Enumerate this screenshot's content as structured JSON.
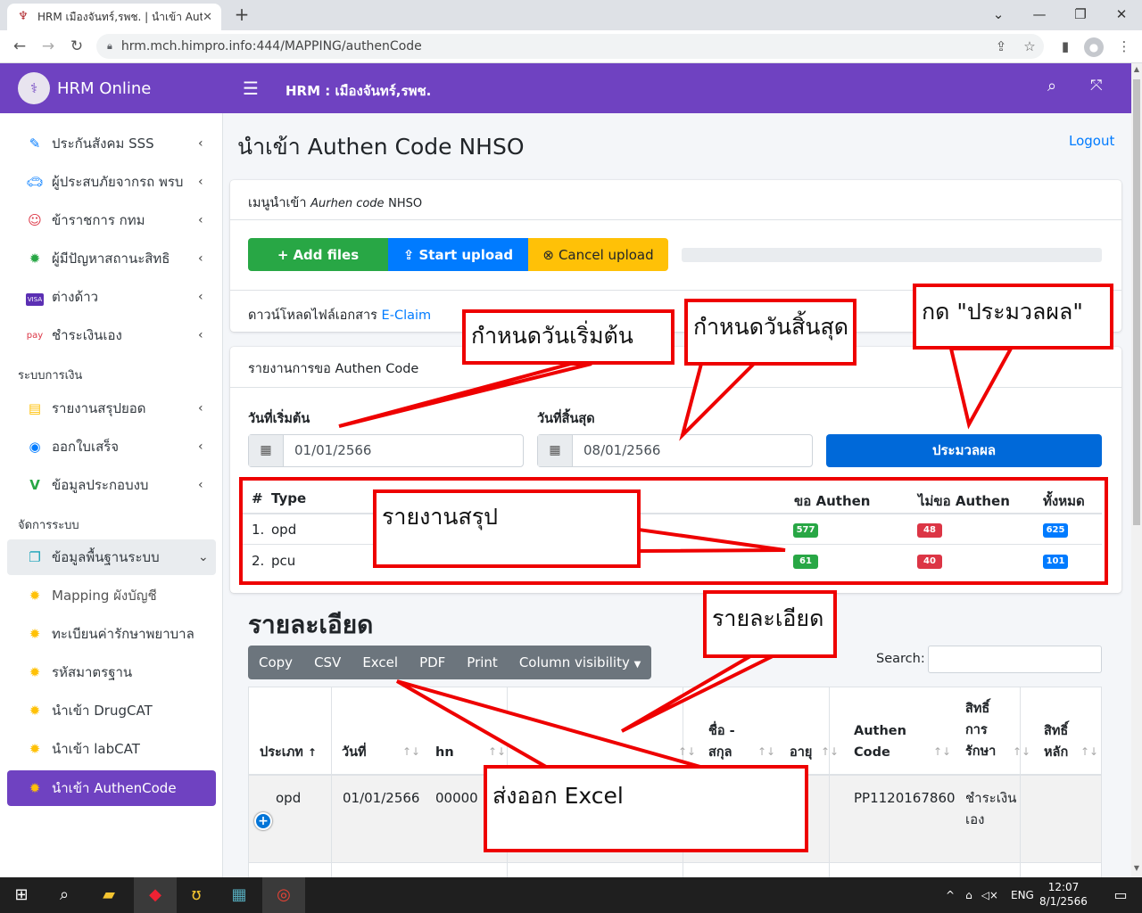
{
  "browser": {
    "tab_title": "HRM เมืองจันทร์,รพช. | นำเข้า Authe",
    "url": "hrm.mch.himpro.info:444/MAPPING/authenCode"
  },
  "brand": {
    "name": "HRM Online"
  },
  "topnav": {
    "title": "HRM : เมืองจันทร์,รพช."
  },
  "sidebar": {
    "items": [
      {
        "label": "ประกันสังคม SSS",
        "icon": "edit-icon"
      },
      {
        "label": "ผู้ประสบภัยจากรถ พรบ",
        "icon": "car-crash-icon"
      },
      {
        "label": "ข้าราชการ กทม",
        "icon": "accessibility-icon"
      },
      {
        "label": "ผู้มีปัญหาสถานะสิทธิ",
        "icon": "gear-icon"
      },
      {
        "label": "ต่างด้าว",
        "icon": "visa-icon"
      },
      {
        "label": "ชำระเงินเอง",
        "icon": "pay-icon"
      }
    ],
    "finance_header": "ระบบการเงิน",
    "finance_items": [
      {
        "label": "รายงานสรุปยอด"
      },
      {
        "label": "ออกใบเสร็จ"
      },
      {
        "label": "ข้อมูลประกอบงบ"
      }
    ],
    "admin_header": "จัดการระบบ",
    "admin_items": [
      {
        "label": "ข้อมูลพื้นฐานระบบ"
      },
      {
        "label": "Mapping ผังบัญชี"
      },
      {
        "label": "ทะเบียนค่ารักษาพยาบาล"
      },
      {
        "label": "รหัสมาตรฐาน"
      },
      {
        "label": "นำเข้า DrugCAT"
      },
      {
        "label": "นำเข้า labCAT"
      },
      {
        "label": "นำเข้า AuthenCode"
      }
    ]
  },
  "page": {
    "title": "นำเข้า Authen Code NHSO",
    "logout": "Logout",
    "import_card_header_prefix": "เมนูนำเข้า",
    "import_card_header_italic": "Aurhen code",
    "import_card_header_suffix": "NHSO",
    "add_files": "Add files",
    "start_upload": "Start upload",
    "cancel_upload": "Cancel upload",
    "download_prefix": "ดาวน์โหลดไฟล์เอกสาร",
    "download_link": "E-Claim",
    "report_header": "รายงานการขอ Authen Code",
    "start_label": "วันที่เริ่มต้น",
    "start_value": "01/01/2566",
    "end_label": "วันที่สิ้นสุด",
    "end_value": "08/01/2566",
    "process_button": "ประมวลผล"
  },
  "summary": {
    "headers": [
      "#",
      "Type",
      "ขอ Authen",
      "ไม่ขอ Authen",
      "ทั้งหมด"
    ],
    "rows": [
      {
        "no": "1.",
        "type": "opd",
        "authen": "577",
        "no_authen": "48",
        "total": "625"
      },
      {
        "no": "2.",
        "type": "pcu",
        "authen": "61",
        "no_authen": "40",
        "total": "101"
      }
    ]
  },
  "detail": {
    "title": "รายละเอียด",
    "buttons": [
      "Copy",
      "CSV",
      "Excel",
      "PDF",
      "Print",
      "Column visibility"
    ],
    "search_label": "Search:",
    "columns": [
      "ประเภท",
      "วันที่",
      "hn",
      "",
      "",
      "ชื่อ -",
      "สกุล",
      "อายุ",
      "Authen",
      "Code",
      "สิทธิ์",
      "การ",
      "รักษา",
      "สิทธิ์",
      "หลัก"
    ],
    "row": {
      "type": "opd",
      "date": "01/01/2566",
      "hn": "00000",
      "authen_code": "PP1120167860",
      "right1": "ชำระเงิน",
      "right2": "เอง"
    }
  },
  "annotations": {
    "start": "กำหนดวันเริ่มต้น",
    "end": "กำหนดวันสิ้นสุด",
    "process": "กด \"ประมวลผล\"",
    "summary": "รายงานสรุป",
    "detail": "รายละเอียด",
    "excel": "ส่งออก Excel"
  },
  "taskbar": {
    "lang": "ENG",
    "time": "12:07",
    "date": "8/1/2566"
  },
  "colors": {
    "primary": "#6f42c1",
    "success": "#28a745",
    "info": "#007bff",
    "warning": "#ffc107",
    "danger": "#dc3545",
    "annotation": "#ee0000"
  }
}
